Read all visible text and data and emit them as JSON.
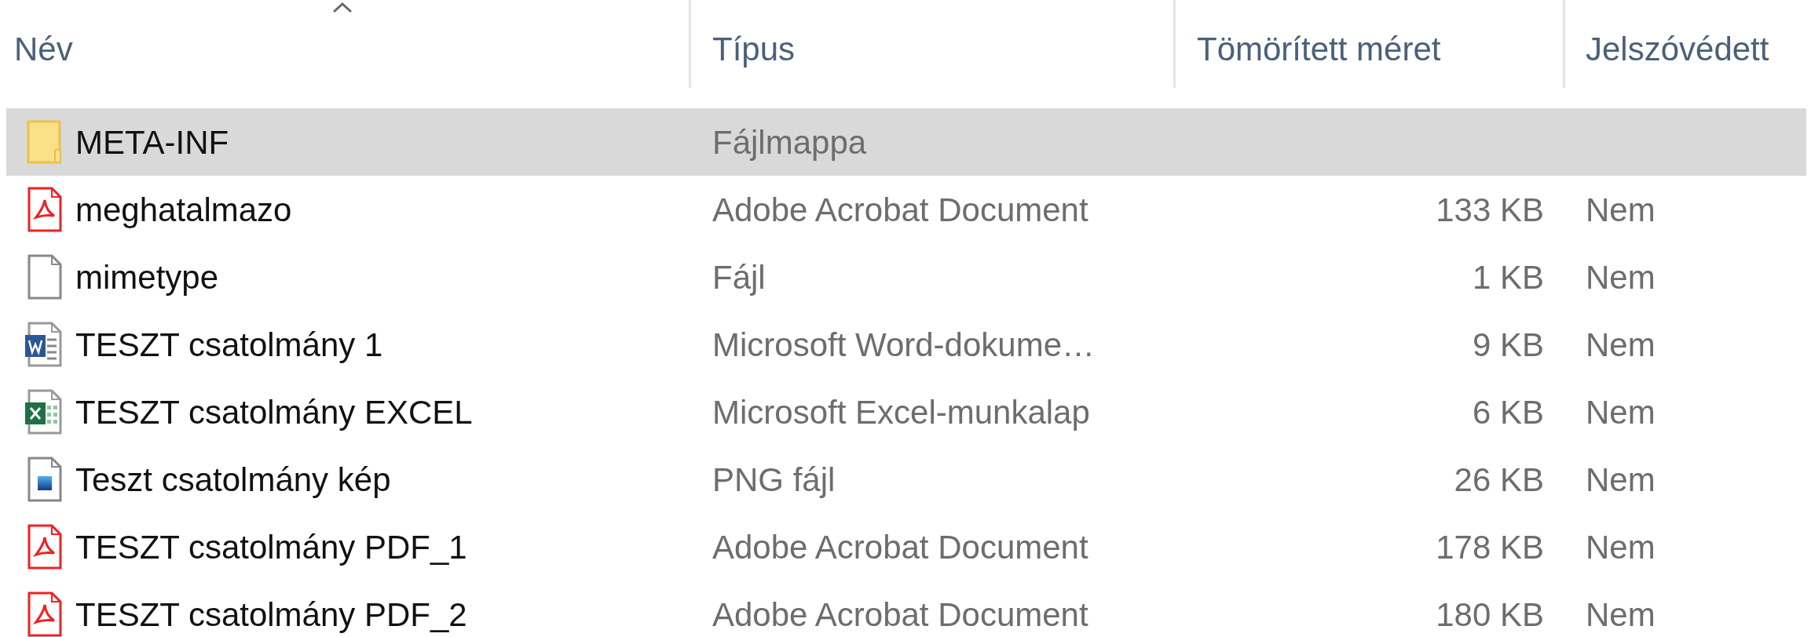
{
  "columns": [
    {
      "label": "Név",
      "sorted": true
    },
    {
      "label": "Típus",
      "sorted": false
    },
    {
      "label": "Tömörített méret",
      "sorted": false
    },
    {
      "label": "Jelszóvédett",
      "sorted": false
    }
  ],
  "rows": [
    {
      "kind": "folder",
      "name": "META-INF",
      "file_type": "Fájlmappa",
      "selected": true
    },
    {
      "kind": "pdf",
      "name": "meghatalmazo",
      "file_type": "Adobe Acrobat Document",
      "size": "133 KB",
      "password": "Nem",
      "selected": false
    },
    {
      "kind": "blank",
      "name": "mimetype",
      "file_type": "Fájl",
      "size": "1 KB",
      "password": "Nem",
      "selected": false
    },
    {
      "kind": "word",
      "name": "TESZT csatolmány 1",
      "file_type": "Microsoft Word-dokume…",
      "size": "9 KB",
      "password": "Nem",
      "selected": false
    },
    {
      "kind": "excel",
      "name": "TESZT csatolmány EXCEL",
      "file_type": "Microsoft Excel-munkalap",
      "size": "6 KB",
      "password": "Nem",
      "selected": false
    },
    {
      "kind": "image",
      "name": "Teszt csatolmány kép",
      "file_type": "PNG fájl",
      "size": "26 KB",
      "password": "Nem",
      "selected": false
    },
    {
      "kind": "pdf",
      "name": "TESZT csatolmány PDF_1",
      "file_type": "Adobe Acrobat Document",
      "size": "178 KB",
      "password": "Nem",
      "selected": false
    },
    {
      "kind": "pdf",
      "name": "TESZT csatolmány PDF_2",
      "file_type": "Adobe Acrobat Document",
      "size": "180 KB",
      "password": "Nem",
      "selected": false
    }
  ]
}
